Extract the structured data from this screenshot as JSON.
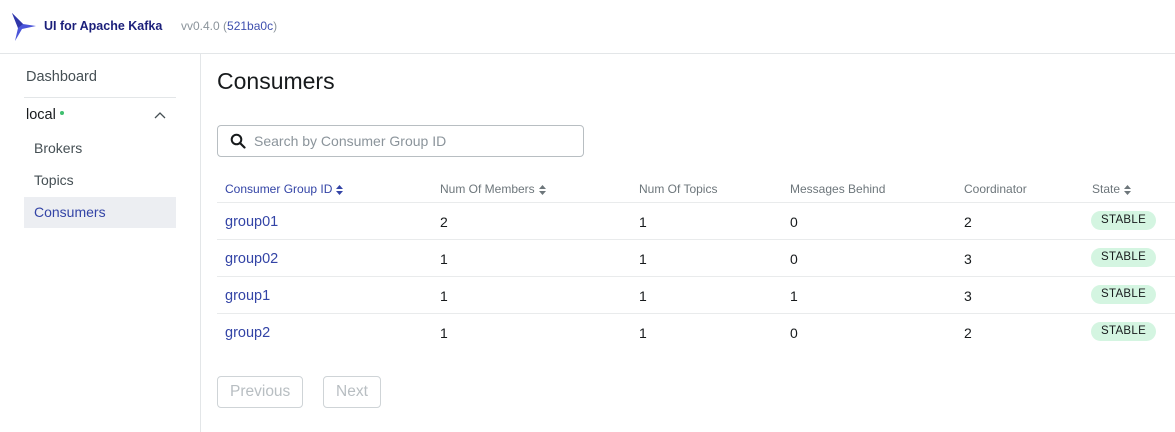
{
  "header": {
    "brand": "UI for Apache Kafka",
    "version_prefix": "vv0.4.0 (",
    "version_hash": "521ba0c",
    "version_suffix": ")"
  },
  "sidebar": {
    "dashboard": "Dashboard",
    "cluster": "local",
    "items": [
      {
        "label": "Brokers",
        "active": false
      },
      {
        "label": "Topics",
        "active": false
      },
      {
        "label": "Consumers",
        "active": true
      }
    ]
  },
  "page": {
    "title": "Consumers",
    "search_placeholder": "Search by Consumer Group ID"
  },
  "table": {
    "columns": [
      "Consumer Group ID",
      "Num Of Members",
      "Num Of Topics",
      "Messages Behind",
      "Coordinator",
      "State"
    ],
    "rows": [
      {
        "group": "group01",
        "members": "2",
        "topics": "1",
        "behind": "0",
        "coordinator": "2",
        "state": "STABLE"
      },
      {
        "group": "group02",
        "members": "1",
        "topics": "1",
        "behind": "0",
        "coordinator": "3",
        "state": "STABLE"
      },
      {
        "group": "group1",
        "members": "1",
        "topics": "1",
        "behind": "1",
        "coordinator": "3",
        "state": "STABLE"
      },
      {
        "group": "group2",
        "members": "1",
        "topics": "1",
        "behind": "0",
        "coordinator": "2",
        "state": "STABLE"
      }
    ]
  },
  "pagination": {
    "previous": "Previous",
    "next": "Next"
  },
  "colors": {
    "accent": "#3344a6",
    "brand": "#1b1f7a",
    "badge_bg": "#d4f5e1",
    "online_dot": "#3fbf6f"
  }
}
